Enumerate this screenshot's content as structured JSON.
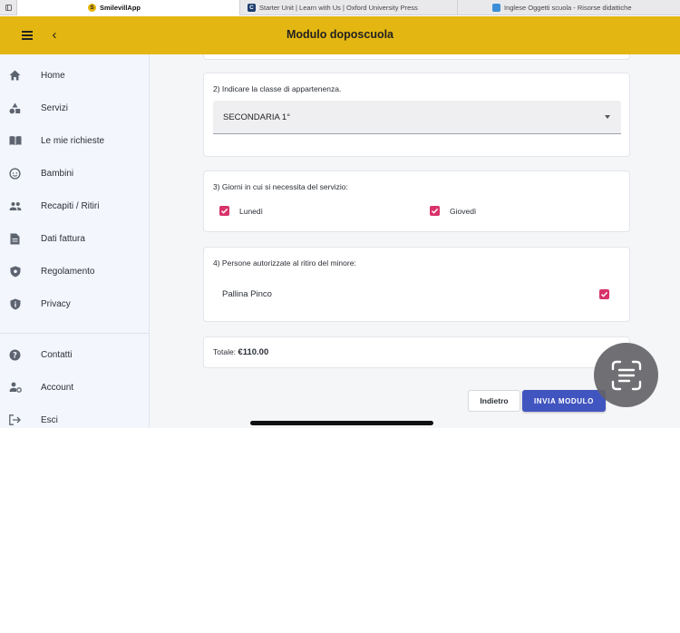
{
  "browser": {
    "tabs": [
      {
        "label": "SmilevillApp",
        "favicon": "S"
      },
      {
        "label": "Starter Unit | Learn with Us | Oxford University Press",
        "favicon": "C"
      },
      {
        "label": "Inglese Oggetti scuola - Risorse didattiche",
        "favicon": ""
      }
    ]
  },
  "appbar": {
    "title": "Modulo doposcuola",
    "color": "#e3b612"
  },
  "sidebar": {
    "items": [
      {
        "label": "Home",
        "icon": "home-icon"
      },
      {
        "label": "Servizi",
        "icon": "shapes-icon"
      },
      {
        "label": "Le mie richieste",
        "icon": "book-icon"
      },
      {
        "label": "Bambini",
        "icon": "child-face-icon"
      },
      {
        "label": "Recapiti / Ritiri",
        "icon": "people-icon"
      },
      {
        "label": "Dati fattura",
        "icon": "document-icon"
      },
      {
        "label": "Regolamento",
        "icon": "shield-icon"
      },
      {
        "label": "Privacy",
        "icon": "shield-info-icon"
      }
    ],
    "bottom_items": [
      {
        "label": "Contatti",
        "icon": "help-icon"
      },
      {
        "label": "Account",
        "icon": "account-settings-icon"
      },
      {
        "label": "Esci",
        "icon": "logout-icon"
      }
    ]
  },
  "form": {
    "class_question": "2) Indicare la classe di appartenenza.",
    "class_value": "SECONDARIA 1°",
    "days_question": "3) Giorni in cui si necessita del servizio:",
    "days": [
      {
        "label": "Lunedì",
        "checked": true
      },
      {
        "label": "Giovedì",
        "checked": true
      }
    ],
    "persons_question": "4) Persone autorizzate al ritiro del minore:",
    "person": {
      "name": "Pallina Pinco",
      "checked": true
    },
    "total_label": "Totale:",
    "total_value": "€110.00",
    "back_label": "Indietro",
    "submit_label": "INVIA MODULO",
    "checkbox_color": "#d8336b",
    "submit_color": "#4155c0"
  }
}
